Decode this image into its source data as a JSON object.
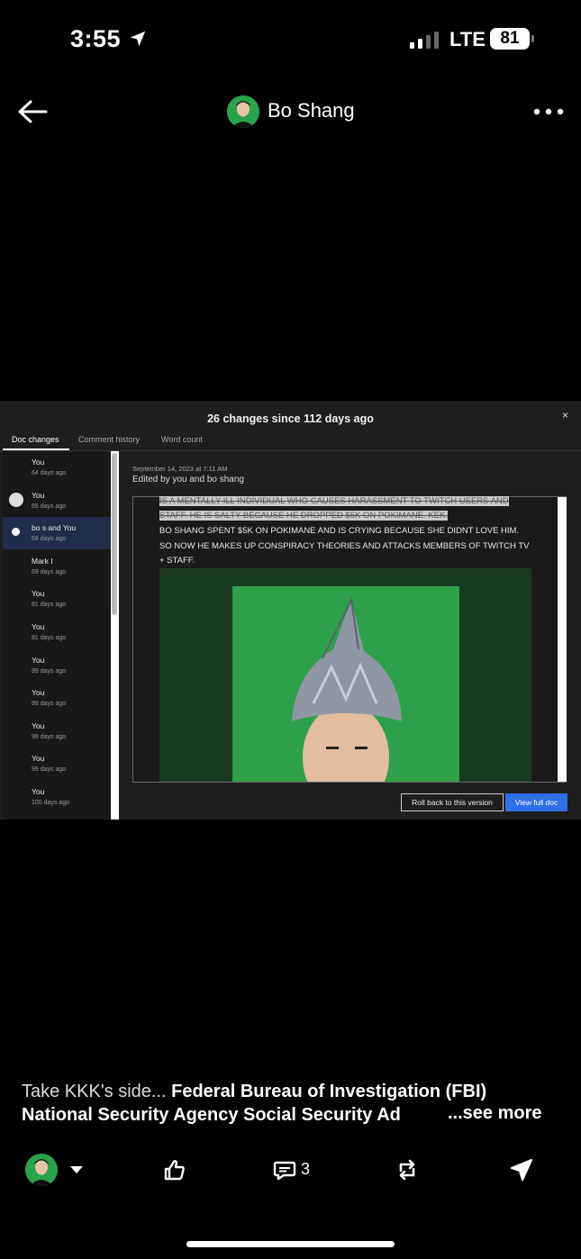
{
  "status_bar": {
    "time": "3:55",
    "network": "LTE",
    "battery": "81"
  },
  "header": {
    "author_name": "Bo Shang"
  },
  "embedded": {
    "title": "26 changes since 112 days ago",
    "close": "×",
    "tabs": [
      "Doc changes",
      "Comment history",
      "Word count"
    ],
    "versions": [
      {
        "name": "You",
        "ago": "64 days ago"
      },
      {
        "name": "You",
        "ago": "65 days ago"
      },
      {
        "name": "bo s and You",
        "ago": "68 days ago"
      },
      {
        "name": "Mark I",
        "ago": "69 days ago"
      },
      {
        "name": "You",
        "ago": "81 days ago"
      },
      {
        "name": "You",
        "ago": "81 days ago"
      },
      {
        "name": "You",
        "ago": "99 days ago"
      },
      {
        "name": "You",
        "ago": "99 days ago"
      },
      {
        "name": "You",
        "ago": "99 days ago"
      },
      {
        "name": "You",
        "ago": "99 days ago"
      },
      {
        "name": "You",
        "ago": "100 days ago"
      }
    ],
    "selected_version_index": 2,
    "meta_date": "September 14, 2023 at 7:11 AM",
    "meta_edited": "Edited by you and bo shang",
    "doc_lines": [
      "IS A MENTALLY ILL INDIVIDUAL WHO CAUSES HARASSMENT TO TWITCH USERS AND",
      "STAFF. HE IS SALTY BECAUSE HE DROPPED $5K ON POKIMANE. KEK.",
      "BO SHANG SPENT $5K ON POKIMANE AND IS CRYING BECAUSE SHE DIDNT LOVE HIM.",
      "SO NOW HE MAKES UP CONSPIRACY THEORIES AND ATTACKS MEMBERS OF TWITCH TV",
      "+ STAFF."
    ],
    "rollback_label": "Roll back to this version",
    "view_full_label": "View full doc"
  },
  "post": {
    "caption_normal": "Take KKK's side... ",
    "caption_bold_1": "Federal Bureau of Investigation (FBI)",
    "caption_bold_2": "National Security Agency Social Security Ad",
    "see_more": "...see more",
    "comment_count": "3"
  }
}
